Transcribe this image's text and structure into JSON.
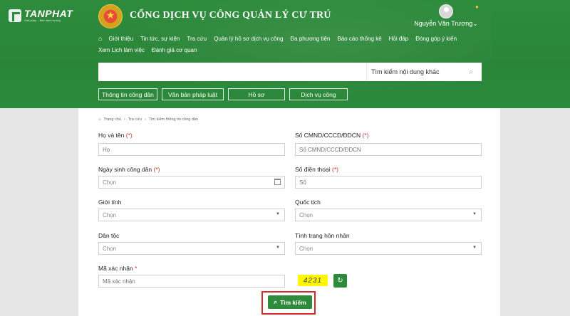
{
  "watermark": {
    "brand": "TANPHAT",
    "tagline": "Giải pháp – Bảo hành tương"
  },
  "header": {
    "title": "CỔNG DỊCH VỤ CÔNG QUẢN LÝ CƯ TRÚ",
    "user_name": "Nguyễn Văn Trương"
  },
  "nav": {
    "row1": [
      "Giới thiệu",
      "Tin tức, sự kiện",
      "Tra cứu",
      "Quản lý hồ sơ dịch vụ công",
      "Đa phương tiện",
      "Báo cáo thống kê",
      "Hỏi đáp",
      "Đóng góp ý kiến"
    ],
    "row2": [
      "Xem Lịch làm việc",
      "Đánh giá cơ quan"
    ]
  },
  "search": {
    "value": "",
    "hint": "Tìm kiếm nội dung khác"
  },
  "quick_links": [
    "Thông tin công dân",
    "Văn bản pháp luật",
    "Hồ sơ",
    "Dịch vụ công"
  ],
  "breadcrumb": [
    "Trang chủ",
    "Tra cứu",
    "Tìm kiếm thông tin công dân"
  ],
  "form": {
    "ho_ten": {
      "label": "Họ và tên",
      "req": "(*)",
      "placeholder": "Họ"
    },
    "so_cmnd": {
      "label": "Số CMND/CCCD/ĐDCN",
      "req": "(*)",
      "placeholder": "Số CMND/CCCD/ĐDCN"
    },
    "ngay_sinh": {
      "label": "Ngày sinh công dân",
      "req": "(*)",
      "placeholder": "Chọn"
    },
    "so_dien_thoai": {
      "label": "Số điện thoại",
      "req": "(*)",
      "placeholder": "Số"
    },
    "gioi_tinh": {
      "label": "Giới tính",
      "value": "Chọn"
    },
    "quoc_tich": {
      "label": "Quốc tịch",
      "value": "Chọn"
    },
    "dan_toc": {
      "label": "Dân tộc",
      "value": "Chọn"
    },
    "hon_nhan": {
      "label": "Tình trạng hôn nhân",
      "value": "Chọn"
    },
    "ma_xac_nhan": {
      "label": "Mã xác nhận",
      "req": "*",
      "placeholder": "Mã xác nhận",
      "captcha": "4231"
    }
  },
  "submit_label": "Tìm kiếm",
  "colors": {
    "brand_green": "#2e8b3c",
    "highlight_red": "#d62b2b",
    "captcha_yellow": "#fff700"
  }
}
